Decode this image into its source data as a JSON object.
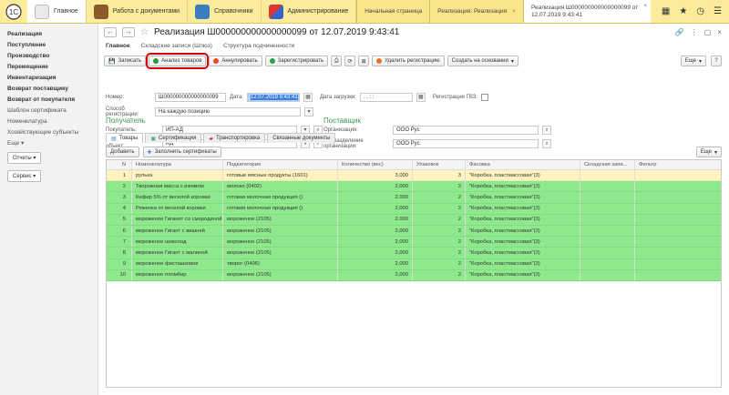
{
  "sections": [
    {
      "label": "Главное",
      "icon": "home-icon",
      "active": true
    },
    {
      "label": "Работа с документами",
      "icon": "briefcase-icon",
      "active": false
    },
    {
      "label": "Справочники",
      "icon": "book-icon",
      "active": false
    },
    {
      "label": "Администрирование",
      "icon": "tools-icon",
      "active": false
    }
  ],
  "window_tabs": [
    {
      "label": "Начальная страница"
    },
    {
      "label": "Реализация: Реализация"
    }
  ],
  "active_window_tab": {
    "line1": "Реализация Ш000000000000000099 от",
    "line2": "12.07.2019 9:43:41"
  },
  "sidebar": {
    "items": [
      {
        "label": "Реализация",
        "bold": true
      },
      {
        "label": "Поступление",
        "bold": true
      },
      {
        "label": "Производство",
        "bold": true
      },
      {
        "label": "Перемещение",
        "bold": true
      },
      {
        "label": "Инвентаризация",
        "bold": true
      },
      {
        "label": "Возврат поставщику",
        "bold": true
      },
      {
        "label": "Возврат от покупателя",
        "bold": true
      },
      {
        "label": "Шаблон сертификата",
        "bold": false
      },
      {
        "label": "Номенклатура",
        "bold": false
      },
      {
        "label": "Хозяйствующие субъекты",
        "bold": false
      }
    ],
    "more": "Еще",
    "reports": "Отчеты",
    "service": "Сервис"
  },
  "doc": {
    "title": "Реализация Ш000000000000000099 от 12.07.2019 9:43:41",
    "tabs": [
      "Главное",
      "Складские записи (Шлюз)",
      "Структура подчиненности"
    ]
  },
  "toolbar": {
    "write": "Записать",
    "analysis": "Анализ товаров",
    "cancel": "Аннулировать",
    "register": "Зарегистрировать",
    "delete_reg": "Удалить регистрацию",
    "create_based": "Создать на основании",
    "more": "Еще"
  },
  "form": {
    "number_label": "Номер:",
    "number_value": "Ш000000000000000099",
    "date_label": "Дата:",
    "date_value": "12.07.2019  9:43:41",
    "load_date_label": "Дата загрузки:",
    "load_date_value": ". .   : :",
    "gvz_label": "Регистрация ГВЗ:",
    "reg_method_label": "Способ регистрации:",
    "reg_method_value": "На каждую позицию",
    "buyer_header": "Получатель",
    "buyer_label": "Покупатель:",
    "buyer_value": "ИП-АД",
    "buyer_obj_label": "Подхозяйный объект:",
    "buyer_obj_value": "АД",
    "supplier_header": "Поставщик",
    "org_label": "Организация:",
    "org_value": "ООО Рус",
    "org_div_label": "Подразделение организации:",
    "org_div_value": "ООО Рус"
  },
  "subtabs": [
    "Товары",
    "Сертификация",
    "Транспортировка",
    "Связанные документы"
  ],
  "grid_toolbar": {
    "add": "Добавить",
    "fill": "Заполнить сертификаты",
    "more": "Еще"
  },
  "columns": [
    "N",
    "Номенклатура",
    "Подкатегория",
    "Количество (вес)",
    "Упаковок",
    "Фасовка",
    "Складская запи...",
    "Фильтр"
  ],
  "rows": [
    {
      "n": "1",
      "name": "рулька",
      "sub": "готовые мясные продукты (1601)",
      "qty": "3,000",
      "pack": "3",
      "fas": "\"Коробка, пластмассовая\"(3)",
      "color": "y"
    },
    {
      "n": "2",
      "name": "Творожная масса с изюмом",
      "sub": "молоко (0402)",
      "qty": "2,000",
      "pack": "2",
      "fas": "\"Коробка, пластмассовая\"(3)",
      "color": "g"
    },
    {
      "n": "3",
      "name": "Кефир 5% от веселой коровки",
      "sub": "готовая молочная продукция ()",
      "qty": "2,000",
      "pack": "2",
      "fas": "\"Коробка, пластмассовая\"(3)",
      "color": "g"
    },
    {
      "n": "4",
      "name": "Ряженка от веселой коровки",
      "sub": "готовая молочная продукция ()",
      "qty": "2,000",
      "pack": "2",
      "fas": "\"Коробка, пластмассовая\"(3)",
      "color": "g"
    },
    {
      "n": "5",
      "name": "мороженое Гиганит со смородиной",
      "sub": "мороженое (2105)",
      "qty": "2,000",
      "pack": "2",
      "fas": "\"Коробка, пластмассовая\"(3)",
      "color": "g"
    },
    {
      "n": "6",
      "name": "мороженое Гигант с вишней",
      "sub": "мороженое (2105)",
      "qty": "2,000",
      "pack": "2",
      "fas": "\"Коробка, пластмассовая\"(3)",
      "color": "g"
    },
    {
      "n": "7",
      "name": "мороженое шоколад",
      "sub": "мороженое (2105)",
      "qty": "2,000",
      "pack": "2",
      "fas": "\"Коробка, пластмассовая\"(3)",
      "color": "g"
    },
    {
      "n": "8",
      "name": "мороженое Гигант с малиной",
      "sub": "мороженое (2105)",
      "qty": "2,000",
      "pack": "2",
      "fas": "\"Коробка, пластмассовая\"(3)",
      "color": "g"
    },
    {
      "n": "9",
      "name": "мороженое фисташковое",
      "sub": "творог (0406)",
      "qty": "2,000",
      "pack": "2",
      "fas": "\"Коробка, пластмассовая\"(3)",
      "color": "g"
    },
    {
      "n": "10",
      "name": "мороженое пломбир",
      "sub": "мороженое (2105)",
      "qty": "2,000",
      "pack": "2",
      "fas": "\"Коробка, пластмассовая\"(3)",
      "color": "g"
    }
  ]
}
